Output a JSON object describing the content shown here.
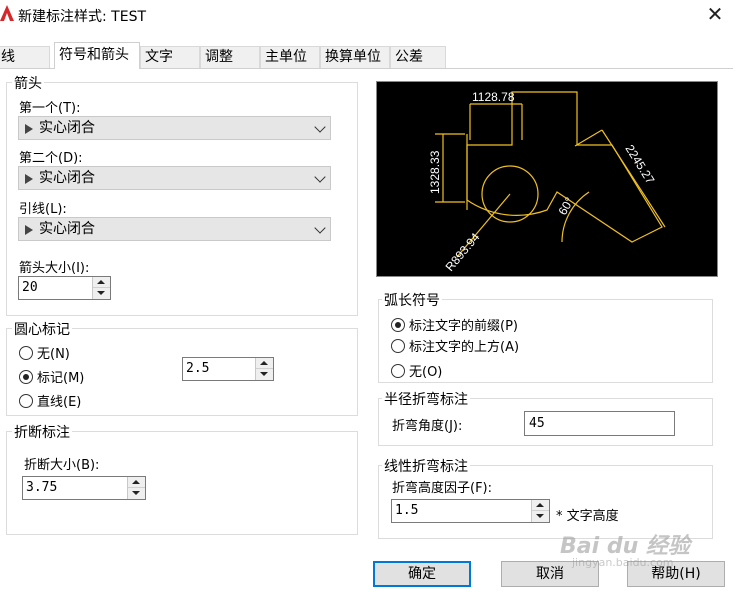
{
  "window": {
    "title": "新建标注样式: TEST",
    "close_glyph": "✕"
  },
  "tabs": [
    {
      "label": "线"
    },
    {
      "label": "符号和箭头"
    },
    {
      "label": "文字"
    },
    {
      "label": "调整"
    },
    {
      "label": "主单位"
    },
    {
      "label": "换算单位"
    },
    {
      "label": "公差"
    }
  ],
  "arrows": {
    "title": "箭头",
    "first_label": "第一个(T):",
    "first_value": "实心闭合",
    "second_label": "第二个(D):",
    "second_value": "实心闭合",
    "leader_label": "引线(L):",
    "leader_value": "实心闭合",
    "size_label": "箭头大小(I):",
    "size_value": "20"
  },
  "center_marks": {
    "title": "圆心标记",
    "options": [
      "无(N)",
      "标记(M)",
      "直线(E)"
    ],
    "selected": "标记(M)",
    "size_value": "2.5"
  },
  "break": {
    "title": "折断标注",
    "size_label": "折断大小(B):",
    "size_value": "3.75"
  },
  "preview": {
    "dim_top": "1128.78",
    "dim_left": "1328.33",
    "dim_diag": "2245.27",
    "angle": "60°",
    "radius": "R893.94",
    "line_color": "#f0c020",
    "text_color": "#ffffff",
    "background": "#000000"
  },
  "arc_symbol": {
    "title": "弧长符号",
    "options": [
      "标注文字的前缀(P)",
      "标注文字的上方(A)",
      "无(O)"
    ],
    "selected": "标注文字的前缀(P)"
  },
  "radius_jog": {
    "title": "半径折弯标注",
    "angle_label": "折弯角度(J):",
    "angle_value": "45"
  },
  "linear_jog": {
    "title": "线性折弯标注",
    "factor_label": "折弯高度因子(F):",
    "factor_value": "1.5",
    "suffix": "* 文字高度"
  },
  "buttons": {
    "ok": "确定",
    "cancel": "取消",
    "help": "帮助(H)"
  },
  "watermark": {
    "logo": "Bai du 经验",
    "url": "jingyan.baidu.com"
  },
  "colors": {
    "accent": "#0078d7",
    "autocad_red": "#d6282a"
  }
}
